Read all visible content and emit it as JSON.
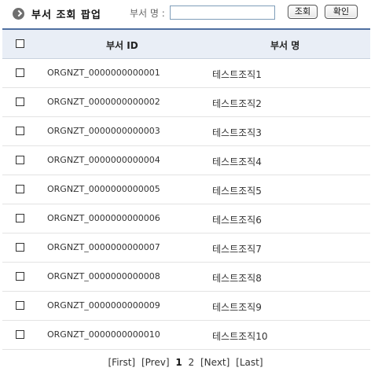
{
  "header": {
    "title": "부서 조회 팝업",
    "search_label": "부서 명 :",
    "search_value": "",
    "search_button": "조회",
    "ok_button": "확인"
  },
  "table": {
    "columns": [
      "부서 ID",
      "부서 명"
    ],
    "rows": [
      {
        "id": "ORGNZT_0000000000001",
        "name": "테스트조직1"
      },
      {
        "id": "ORGNZT_0000000000002",
        "name": "테스트조직2"
      },
      {
        "id": "ORGNZT_0000000000003",
        "name": "테스트조직3"
      },
      {
        "id": "ORGNZT_0000000000004",
        "name": "테스트조직4"
      },
      {
        "id": "ORGNZT_0000000000005",
        "name": "테스트조직5"
      },
      {
        "id": "ORGNZT_0000000000006",
        "name": "테스트조직6"
      },
      {
        "id": "ORGNZT_0000000000007",
        "name": "테스트조직7"
      },
      {
        "id": "ORGNZT_0000000000008",
        "name": "테스트조직8"
      },
      {
        "id": "ORGNZT_0000000000009",
        "name": "테스트조직9"
      },
      {
        "id": "ORGNZT_0000000000010",
        "name": "테스트조직10"
      }
    ]
  },
  "pager": {
    "first": "[First]",
    "prev": "[Prev]",
    "pages": [
      "1",
      "2"
    ],
    "current": "1",
    "next": "[Next]",
    "last": "[Last]"
  },
  "icons": {
    "title_bullet": "arrow-right-circle-icon"
  }
}
